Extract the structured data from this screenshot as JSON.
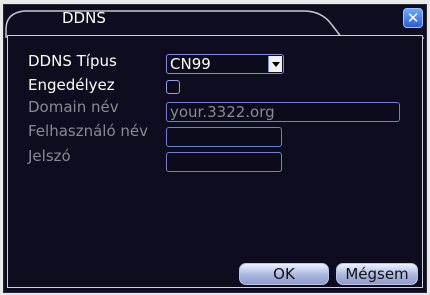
{
  "dialog": {
    "title": "DDNS",
    "close_icon": "close-icon"
  },
  "form": {
    "ddns_type_label": "DDNS Típus",
    "ddns_type_value": "CN99",
    "enable_label": "Engedélyez",
    "enable_checked": false,
    "domain_label": "Domain név",
    "domain_value": "your.3322.org",
    "username_label": "Felhasználó név",
    "username_value": "",
    "password_label": "Jelszó",
    "password_value": ""
  },
  "buttons": {
    "ok_label": "OK",
    "cancel_label": "Mégsem"
  },
  "colors": {
    "background": "#0d0d1f",
    "accent": "#6f7fd4",
    "close": "#2c5ed8"
  }
}
